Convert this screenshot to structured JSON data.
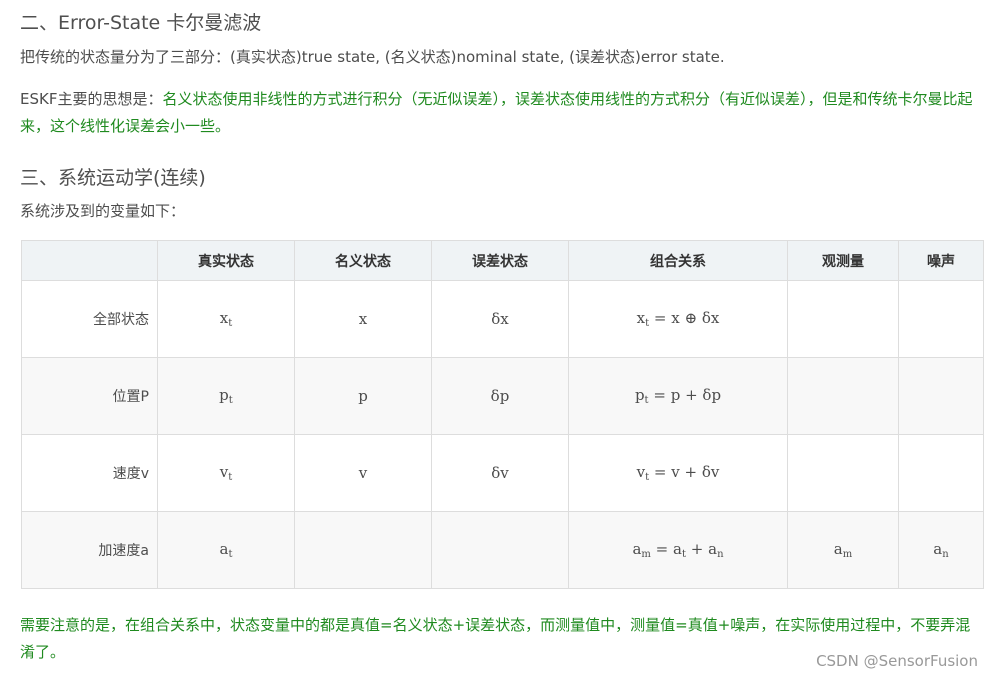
{
  "section2": {
    "heading": "二、Error-State 卡尔曼滤波",
    "para1": "把传统的状态量分为了三部分：(真实状态)true state, (名义状态)nominal state, (误差状态)error state.",
    "para2_lead": "ESKF主要的思想是：",
    "para2_green": "名义状态使用非线性的方式进行积分（无近似误差），误差状态使用线性的方式积分（有近似误差），但是和传统卡尔曼比起来，这个线性化误差会小一些。"
  },
  "section3": {
    "heading": "三、系统运动学(连续)",
    "intro": "系统涉及到的变量如下："
  },
  "table": {
    "headers": [
      "",
      "真实状态",
      "名义状态",
      "误差状态",
      "组合关系",
      "观测量",
      "噪声"
    ],
    "rows": [
      {
        "label": "全部状态",
        "true_state": {
          "base": "x",
          "sub": "t"
        },
        "nominal": "x",
        "error": "δx",
        "relation": {
          "lhs": "x",
          "lhs_sub": "t",
          "op": "=",
          "rhs": "x ⊕ δx"
        },
        "observation": "",
        "noise": ""
      },
      {
        "label": "位置P",
        "true_state": {
          "base": "p",
          "sub": "t"
        },
        "nominal": "p",
        "error": "δp",
        "relation": {
          "lhs": "p",
          "lhs_sub": "t",
          "op": "=",
          "rhs": "p + δp"
        },
        "observation": "",
        "noise": ""
      },
      {
        "label": "速度v",
        "true_state": {
          "base": "v",
          "sub": "t"
        },
        "nominal": "v",
        "error": "δv",
        "relation": {
          "lhs": "v",
          "lhs_sub": "t",
          "op": "=",
          "rhs": "v + δv"
        },
        "observation": "",
        "noise": ""
      },
      {
        "label": "加速度a",
        "true_state": {
          "base": "a",
          "sub": "t"
        },
        "nominal": "",
        "error": "",
        "relation": {
          "lhs": "a",
          "lhs_sub": "m",
          "op": "=",
          "rhs": "a",
          "rhs_sub": "t",
          "rhs2": "+ a",
          "rhs2_sub": "n"
        },
        "observation": {
          "base": "a",
          "sub": "m"
        },
        "noise": {
          "base": "a",
          "sub": "n"
        }
      }
    ]
  },
  "note": {
    "text": "需要注意的是，在组合关系中，状态变量中的都是真值=名义状态+误差状态，而测量值中，测量值=真值+噪声，在实际使用过程中，不要弄混淆了。"
  },
  "watermark": "CSDN @SensorFusion",
  "colors": {
    "green_text": "#1f8a1f",
    "header_bg": "#eff3f5",
    "border": "#dddddd"
  }
}
